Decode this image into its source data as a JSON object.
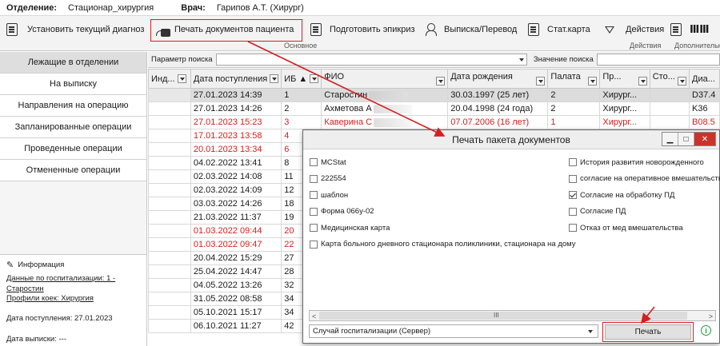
{
  "topbar": {
    "dept_label": "Отделение:",
    "dept_value": "Стационар_хирургия",
    "doctor_label": "Врач:",
    "doctor_value": "Гарипов А.Т. (Хирург)"
  },
  "ribbon": {
    "set_diag": "Установить текущий диагноз",
    "print_docs": "Печать документов пациента",
    "epicrisis": "Подготовить эпикриз",
    "extract": "Выписка/Перевод",
    "stat_card": "Стат.карта",
    "actions": "Действия",
    "group_main": "Основное",
    "group_actions": "Действия",
    "group_extra": "Дополнительн"
  },
  "sidebar": {
    "items": [
      {
        "label": "Лежащие в отделении",
        "active": true
      },
      {
        "label": "На выписку"
      },
      {
        "label": "Направления на операцию"
      },
      {
        "label": "Запланированные операции"
      },
      {
        "label": "Проведенные операции"
      },
      {
        "label": "Отмененные операции"
      }
    ],
    "info": {
      "title": "Информация",
      "hosp_link": "Данные по госпитализации: 1 -",
      "patient_link": "Старостин",
      "profile_link": "Профили коек: Хирургия",
      "admit_date": "Дата поступления: 27.01.2023",
      "discharge": "Дата выписки: ---"
    }
  },
  "search": {
    "param_label": "Параметр поиска",
    "value_label": "Значение поиска",
    "param_value": ""
  },
  "table": {
    "headers": [
      "Инд...",
      "Дата поступления",
      "ИБ ▲",
      "ФИО",
      "Дата рождения",
      "Палата",
      "Пр...",
      "Сто...",
      "Диа..."
    ],
    "rows": [
      {
        "date": "27.01.2023 14:39",
        "ib": "1",
        "fio": "Старостин",
        "dob": "30.03.1997 (25 лет)",
        "ward": "2",
        "pr": "Хирург...",
        "diag": "D37.4",
        "red": false
      },
      {
        "date": "27.01.2023 14:26",
        "ib": "2",
        "fio": "Ахметова А",
        "dob": "20.04.1998 (24 года)",
        "ward": "2",
        "pr": "Хирург...",
        "diag": "K36",
        "red": false
      },
      {
        "date": "27.01.2023 15:23",
        "ib": "3",
        "fio": "Каверина С",
        "dob": "07.07.2006 (16 лет)",
        "ward": "1",
        "pr": "Хирург...",
        "diag": "B08.5",
        "red": true
      },
      {
        "date": "17.01.2023 13:58",
        "ib": "4",
        "red": true
      },
      {
        "date": "20.01.2023 13:34",
        "ib": "6",
        "red": true
      },
      {
        "date": "04.02.2022 13:41",
        "ib": "8",
        "red": false
      },
      {
        "date": "02.03.2022 14:08",
        "ib": "11",
        "red": false
      },
      {
        "date": "02.03.2022 14:09",
        "ib": "12",
        "red": false
      },
      {
        "date": "03.03.2022 14:26",
        "ib": "18",
        "red": false
      },
      {
        "date": "21.03.2022 11:37",
        "ib": "19",
        "red": false
      },
      {
        "date": "01.03.2022 09:44",
        "ib": "20",
        "red": true
      },
      {
        "date": "01.03.2022 09:47",
        "ib": "22",
        "red": true
      },
      {
        "date": "20.04.2022 15:29",
        "ib": "27",
        "red": false
      },
      {
        "date": "25.04.2022 14:47",
        "ib": "28",
        "red": false
      },
      {
        "date": "04.05.2022 13:26",
        "ib": "32",
        "red": false
      },
      {
        "date": "31.05.2022 08:58",
        "ib": "34",
        "red": false
      },
      {
        "date": "05.10.2021 15:17",
        "ib": "34",
        "red": false
      },
      {
        "date": "06.10.2021 11:27",
        "ib": "42",
        "red": false
      }
    ]
  },
  "modal": {
    "title": "Печать пакета документов",
    "left_items": [
      {
        "label": "MCStat",
        "checked": false
      },
      {
        "label": "222554",
        "checked": false
      },
      {
        "label": "шаблон",
        "checked": false
      },
      {
        "label": "Форма 066у-02",
        "checked": false
      },
      {
        "label": "Медицинская карта",
        "checked": false
      },
      {
        "label": "Карта больного дневного стационара поликлиники, стационара на дому",
        "checked": false
      }
    ],
    "right_items": [
      {
        "label": "История развития новорожденного",
        "checked": false
      },
      {
        "label": "согласие на оперативное вмешательство",
        "checked": false
      },
      {
        "label": "Согласие на обработку ПД",
        "checked": true
      },
      {
        "label": "Согласие ПД",
        "checked": false
      },
      {
        "label": "Отказ от мед вмешательства",
        "checked": false
      }
    ],
    "select_value": "Случай госпитализации (Сервер)",
    "print_button": "Печать",
    "scroll_grip": "III"
  },
  "colors": {
    "annotation": "#d32020",
    "red_text": "#d42020",
    "info_green": "#1e9a3c"
  }
}
